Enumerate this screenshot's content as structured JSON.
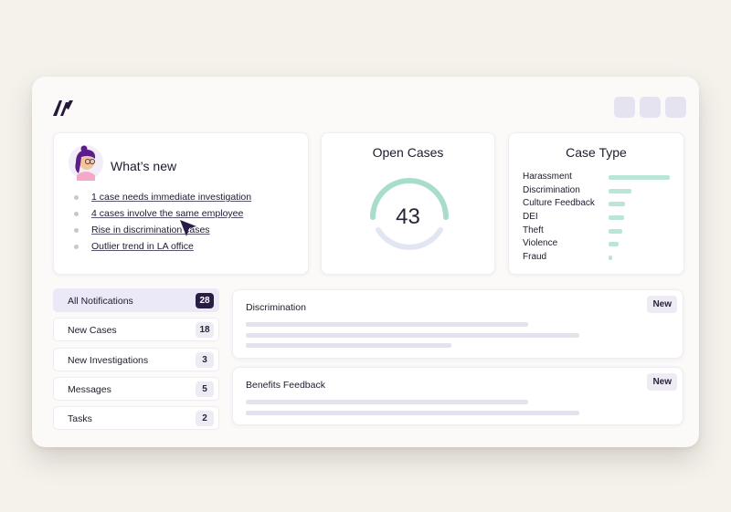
{
  "whats_new": {
    "title": "What’s new",
    "items": [
      "1 case needs immediate investigation",
      "4 cases involve the same employee",
      "Rise in discrimination cases",
      "Outlier trend in LA office"
    ]
  },
  "open_cases": {
    "title": "Open Cases",
    "value": "43"
  },
  "case_type": {
    "title": "Case Type",
    "chart_data": {
      "type": "bar",
      "categories": [
        "Harassment",
        "Discrimination",
        "Culture Feedback",
        "DEI",
        "Theft",
        "Violence",
        "Fraud"
      ],
      "values": [
        100,
        37,
        27,
        25,
        23,
        17,
        6
      ],
      "bar_color": "#b9e6d6"
    }
  },
  "notifications": [
    {
      "label": "All Notifications",
      "count": "28",
      "active": true
    },
    {
      "label": "New Cases",
      "count": "18"
    },
    {
      "label": "New Investigations",
      "count": "3"
    },
    {
      "label": "Messages",
      "count": "5"
    },
    {
      "label": "Tasks",
      "count": "2"
    }
  ],
  "messages": [
    {
      "title": "Discrimination",
      "badge": "New"
    },
    {
      "title": "Benefits Feedback",
      "badge": "New"
    }
  ],
  "colors": {
    "background": "#f5f2ec",
    "accent_dark": "#2a1d45",
    "gauge_green": "#a8dccb",
    "gauge_track": "#e1e6f2"
  }
}
